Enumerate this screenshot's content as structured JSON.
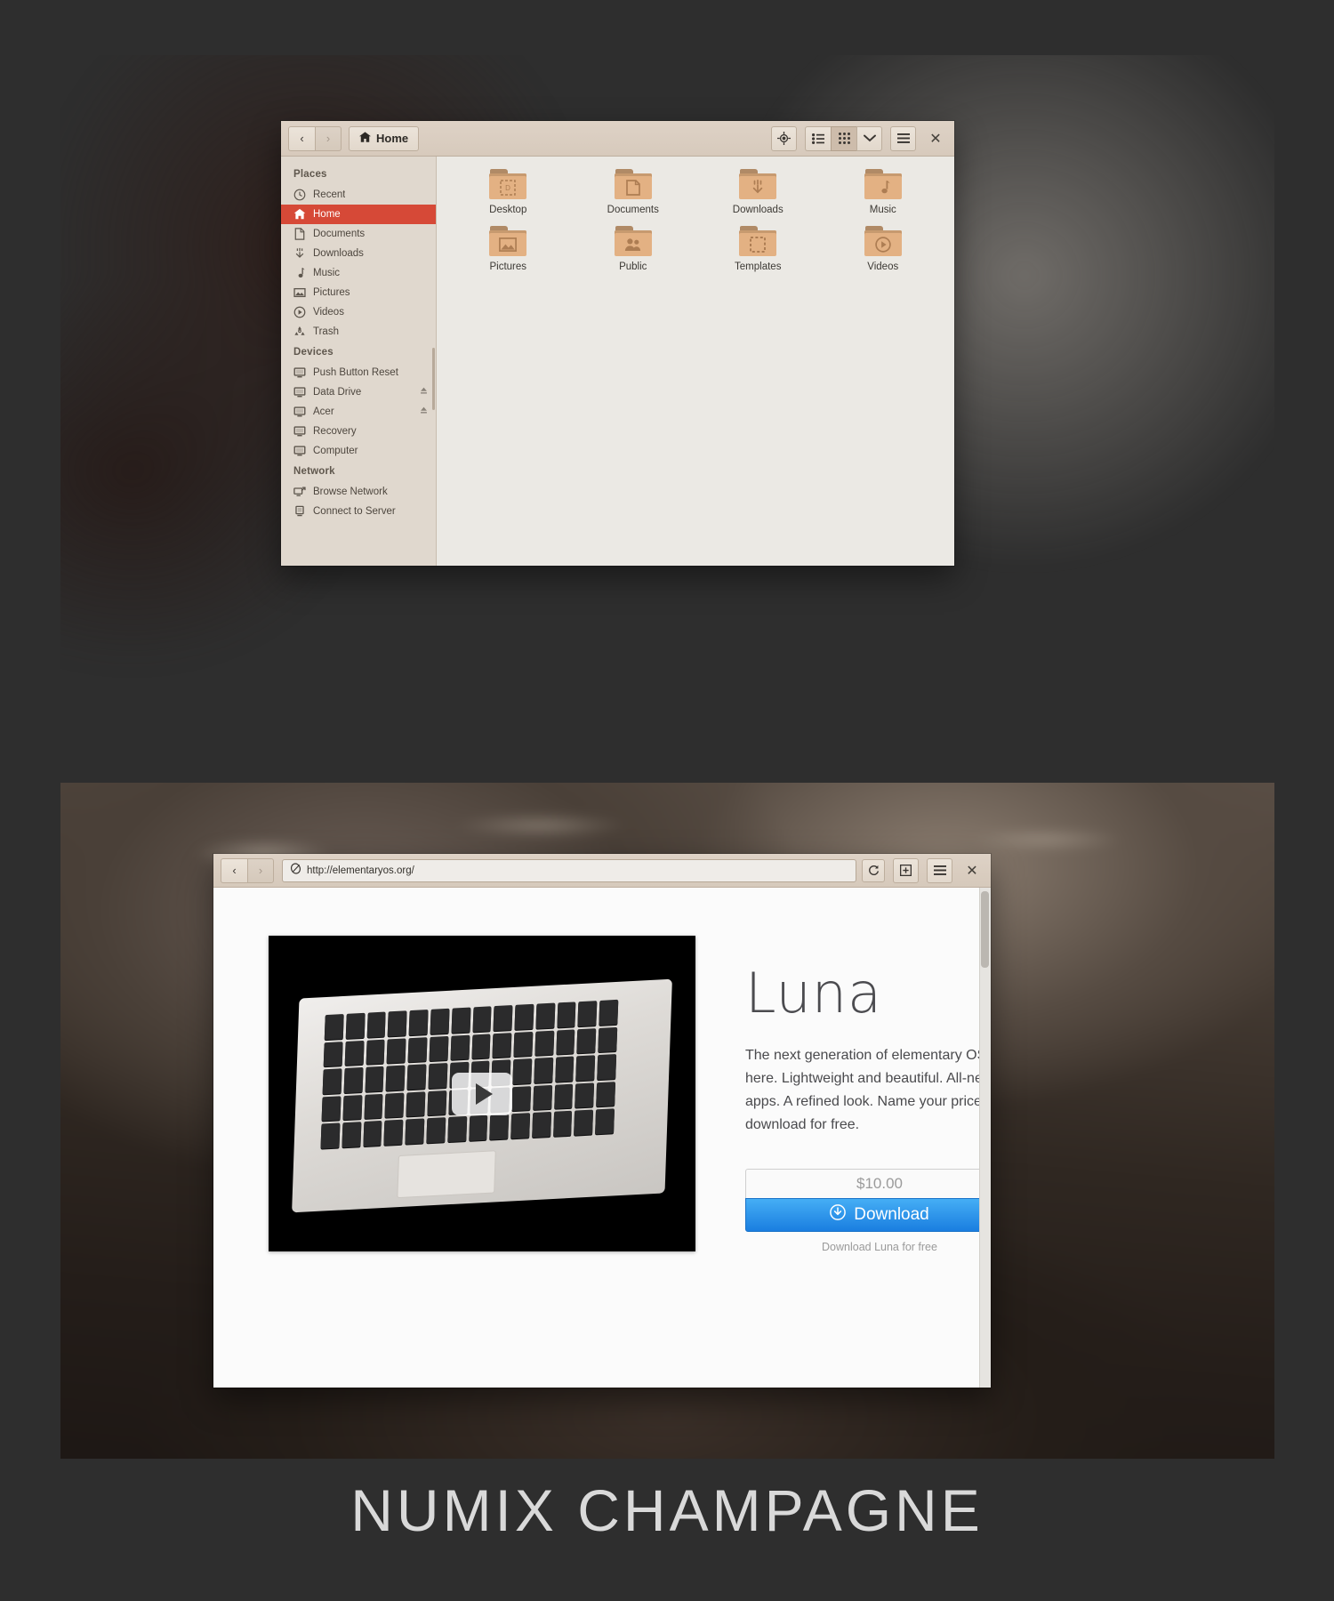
{
  "footer": {
    "title": "NUMIX CHAMPAGNE"
  },
  "theme": {
    "accent": "#d64937",
    "chrome_bg": "#ded2c6",
    "sidebar_bg": "#e0d8ce",
    "content_bg": "#ebe9e4",
    "download_blue": "#1a7ee0",
    "page_bg": "#2e2e2e"
  },
  "file_manager": {
    "nav": {
      "back": "‹",
      "forward": "›"
    },
    "path_label": "Home",
    "path_icon": "home-icon",
    "toolbar": [
      {
        "name": "location-icon",
        "label": "",
        "active": false
      },
      {
        "name": "list-view-icon",
        "label": "",
        "active": false
      },
      {
        "name": "grid-view-icon",
        "label": "",
        "active": true
      },
      {
        "name": "chevron-down-icon",
        "label": "",
        "active": false
      },
      {
        "name": "menu-icon",
        "label": "",
        "active": false
      }
    ],
    "close_label": "✕",
    "sidebar": [
      {
        "type": "header",
        "label": "Places"
      },
      {
        "type": "item",
        "label": "Recent",
        "icon": "clock-icon",
        "selected": false,
        "eject": false
      },
      {
        "type": "item",
        "label": "Home",
        "icon": "home-icon",
        "selected": true,
        "eject": false
      },
      {
        "type": "item",
        "label": "Documents",
        "icon": "document-icon",
        "selected": false,
        "eject": false
      },
      {
        "type": "item",
        "label": "Downloads",
        "icon": "download-icon",
        "selected": false,
        "eject": false
      },
      {
        "type": "item",
        "label": "Music",
        "icon": "music-icon",
        "selected": false,
        "eject": false
      },
      {
        "type": "item",
        "label": "Pictures",
        "icon": "image-icon",
        "selected": false,
        "eject": false
      },
      {
        "type": "item",
        "label": "Videos",
        "icon": "video-icon",
        "selected": false,
        "eject": false
      },
      {
        "type": "item",
        "label": "Trash",
        "icon": "trash-icon",
        "selected": false,
        "eject": false
      },
      {
        "type": "header",
        "label": "Devices"
      },
      {
        "type": "item",
        "label": "Push Button Reset",
        "icon": "drive-icon",
        "selected": false,
        "eject": false
      },
      {
        "type": "item",
        "label": "Data Drive",
        "icon": "drive-icon",
        "selected": false,
        "eject": true
      },
      {
        "type": "item",
        "label": "Acer",
        "icon": "drive-icon",
        "selected": false,
        "eject": true
      },
      {
        "type": "item",
        "label": "Recovery",
        "icon": "drive-icon",
        "selected": false,
        "eject": false
      },
      {
        "type": "item",
        "label": "Computer",
        "icon": "drive-icon",
        "selected": false,
        "eject": false
      },
      {
        "type": "header",
        "label": "Network"
      },
      {
        "type": "item",
        "label": "Browse Network",
        "icon": "network-icon",
        "selected": false,
        "eject": false
      },
      {
        "type": "item",
        "label": "Connect to Server",
        "icon": "server-icon",
        "selected": false,
        "eject": false
      }
    ],
    "folders": [
      {
        "label": "Desktop",
        "glyph": "desktop-glyph"
      },
      {
        "label": "Documents",
        "glyph": "document-glyph"
      },
      {
        "label": "Downloads",
        "glyph": "download-glyph"
      },
      {
        "label": "Music",
        "glyph": "music-glyph"
      },
      {
        "label": "Pictures",
        "glyph": "image-glyph"
      },
      {
        "label": "Public",
        "glyph": "people-glyph"
      },
      {
        "label": "Templates",
        "glyph": "template-glyph"
      },
      {
        "label": "Videos",
        "glyph": "video-glyph"
      }
    ]
  },
  "browser": {
    "nav": {
      "back": "‹",
      "forward": "›"
    },
    "url": "http://elementaryos.org/",
    "url_icon": "midori-icon",
    "reload_label": "↻",
    "new_tab_icon": "new-tab-icon",
    "menu_icon": "menu-icon",
    "close_label": "✕",
    "page": {
      "video_play_label": "play-button",
      "heading": "Luna",
      "body": "The next generation of elementary OS is here. Lightweight and beautiful. All-new apps. A refined look. Name your price or download for free.",
      "price": "$10.00",
      "download_label": "Download",
      "download_icon": "download-circle-icon",
      "free_link": "Download Luna for free"
    }
  }
}
